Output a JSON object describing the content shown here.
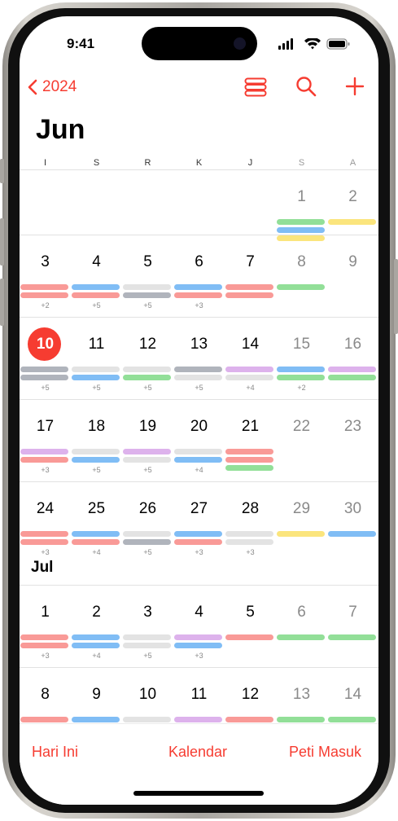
{
  "status": {
    "time": "9:41"
  },
  "nav": {
    "back_label": "2024",
    "icons": [
      "chevron-left-icon",
      "list-view-icon",
      "search-icon",
      "plus-icon"
    ]
  },
  "month_title": "Jun",
  "weekdays": [
    "I",
    "S",
    "R",
    "K",
    "J",
    "S",
    "A"
  ],
  "colors": {
    "accent": "#f63c31",
    "green": "#92df98",
    "blue": "#80bdf5",
    "yellow": "#fbe57d",
    "red": "#f99a97",
    "gray": "#b0b4bc",
    "light": "#e3e3e3",
    "purple": "#ddb2ec"
  },
  "weeks": [
    {
      "days": [
        {
          "n": "",
          "bars": [],
          "more": ""
        },
        {
          "n": "",
          "bars": [],
          "more": ""
        },
        {
          "n": "",
          "bars": [],
          "more": ""
        },
        {
          "n": "",
          "bars": [],
          "more": ""
        },
        {
          "n": "",
          "bars": [],
          "more": ""
        },
        {
          "n": "1",
          "bars": [
            "green",
            "blue",
            "yellow"
          ],
          "more": ""
        },
        {
          "n": "2",
          "bars": [
            "yellow"
          ],
          "more": ""
        }
      ]
    },
    {
      "days": [
        {
          "n": "3",
          "bars": [
            "red",
            "red"
          ],
          "more": "+2"
        },
        {
          "n": "4",
          "bars": [
            "blue",
            "red"
          ],
          "more": "+5"
        },
        {
          "n": "5",
          "bars": [
            "light",
            "gray"
          ],
          "more": "+5"
        },
        {
          "n": "6",
          "bars": [
            "blue",
            "red"
          ],
          "more": "+3"
        },
        {
          "n": "7",
          "bars": [
            "red",
            "red"
          ],
          "more": ""
        },
        {
          "n": "8",
          "bars": [
            "green"
          ],
          "more": ""
        },
        {
          "n": "9",
          "bars": [],
          "more": ""
        }
      ]
    },
    {
      "days": [
        {
          "n": "10",
          "today": true,
          "bars": [
            "gray",
            "gray"
          ],
          "more": "+5"
        },
        {
          "n": "11",
          "bars": [
            "light",
            "blue"
          ],
          "more": "+5"
        },
        {
          "n": "12",
          "bars": [
            "light",
            "green"
          ],
          "more": "+5"
        },
        {
          "n": "13",
          "bars": [
            "gray",
            "light"
          ],
          "more": "+5"
        },
        {
          "n": "14",
          "bars": [
            "purple",
            "light"
          ],
          "more": "+4"
        },
        {
          "n": "15",
          "bars": [
            "blue",
            "green"
          ],
          "more": "+2"
        },
        {
          "n": "16",
          "bars": [
            "purple",
            "green"
          ],
          "more": ""
        }
      ]
    },
    {
      "days": [
        {
          "n": "17",
          "bars": [
            "purple",
            "red"
          ],
          "more": "+3"
        },
        {
          "n": "18",
          "bars": [
            "light",
            "blue"
          ],
          "more": "+5"
        },
        {
          "n": "19",
          "bars": [
            "purple",
            "light"
          ],
          "more": "+5"
        },
        {
          "n": "20",
          "bars": [
            "light",
            "blue"
          ],
          "more": "+4"
        },
        {
          "n": "21",
          "bars": [
            "red",
            "red",
            "green"
          ],
          "more": ""
        },
        {
          "n": "22",
          "bars": [],
          "more": ""
        },
        {
          "n": "23",
          "bars": [],
          "more": ""
        }
      ]
    },
    {
      "days": [
        {
          "n": "24",
          "bars": [
            "red",
            "red"
          ],
          "more": "+3"
        },
        {
          "n": "25",
          "bars": [
            "blue",
            "red"
          ],
          "more": "+4"
        },
        {
          "n": "26",
          "bars": [
            "light",
            "gray"
          ],
          "more": "+5"
        },
        {
          "n": "27",
          "bars": [
            "blue",
            "red"
          ],
          "more": "+3"
        },
        {
          "n": "28",
          "bars": [
            "light",
            "light"
          ],
          "more": "+3"
        },
        {
          "n": "29",
          "bars": [
            "yellow"
          ],
          "more": ""
        },
        {
          "n": "30",
          "bars": [
            "blue"
          ],
          "more": ""
        }
      ]
    }
  ],
  "next_month_label": "Jul",
  "jul_weeks": [
    {
      "days": [
        {
          "n": "1",
          "bars": [
            "red",
            "red"
          ],
          "more": "+3"
        },
        {
          "n": "2",
          "bars": [
            "blue",
            "blue"
          ],
          "more": "+4"
        },
        {
          "n": "3",
          "bars": [
            "light",
            "light"
          ],
          "more": "+5"
        },
        {
          "n": "4",
          "bars": [
            "purple",
            "blue"
          ],
          "more": "+3"
        },
        {
          "n": "5",
          "bars": [
            "red"
          ],
          "more": ""
        },
        {
          "n": "6",
          "bars": [
            "green"
          ],
          "more": ""
        },
        {
          "n": "7",
          "bars": [
            "green"
          ],
          "more": ""
        }
      ]
    },
    {
      "days": [
        {
          "n": "8",
          "bars": [
            "red"
          ],
          "more": ""
        },
        {
          "n": "9",
          "bars": [
            "blue"
          ],
          "more": ""
        },
        {
          "n": "10",
          "bars": [
            "light"
          ],
          "more": ""
        },
        {
          "n": "11",
          "bars": [
            "purple"
          ],
          "more": ""
        },
        {
          "n": "12",
          "bars": [
            "red"
          ],
          "more": ""
        },
        {
          "n": "13",
          "bars": [
            "green"
          ],
          "more": ""
        },
        {
          "n": "14",
          "bars": [
            "green"
          ],
          "more": ""
        }
      ]
    }
  ],
  "tabbar": {
    "today": "Hari Ini",
    "calendars": "Kalendar",
    "inbox": "Peti Masuk"
  }
}
